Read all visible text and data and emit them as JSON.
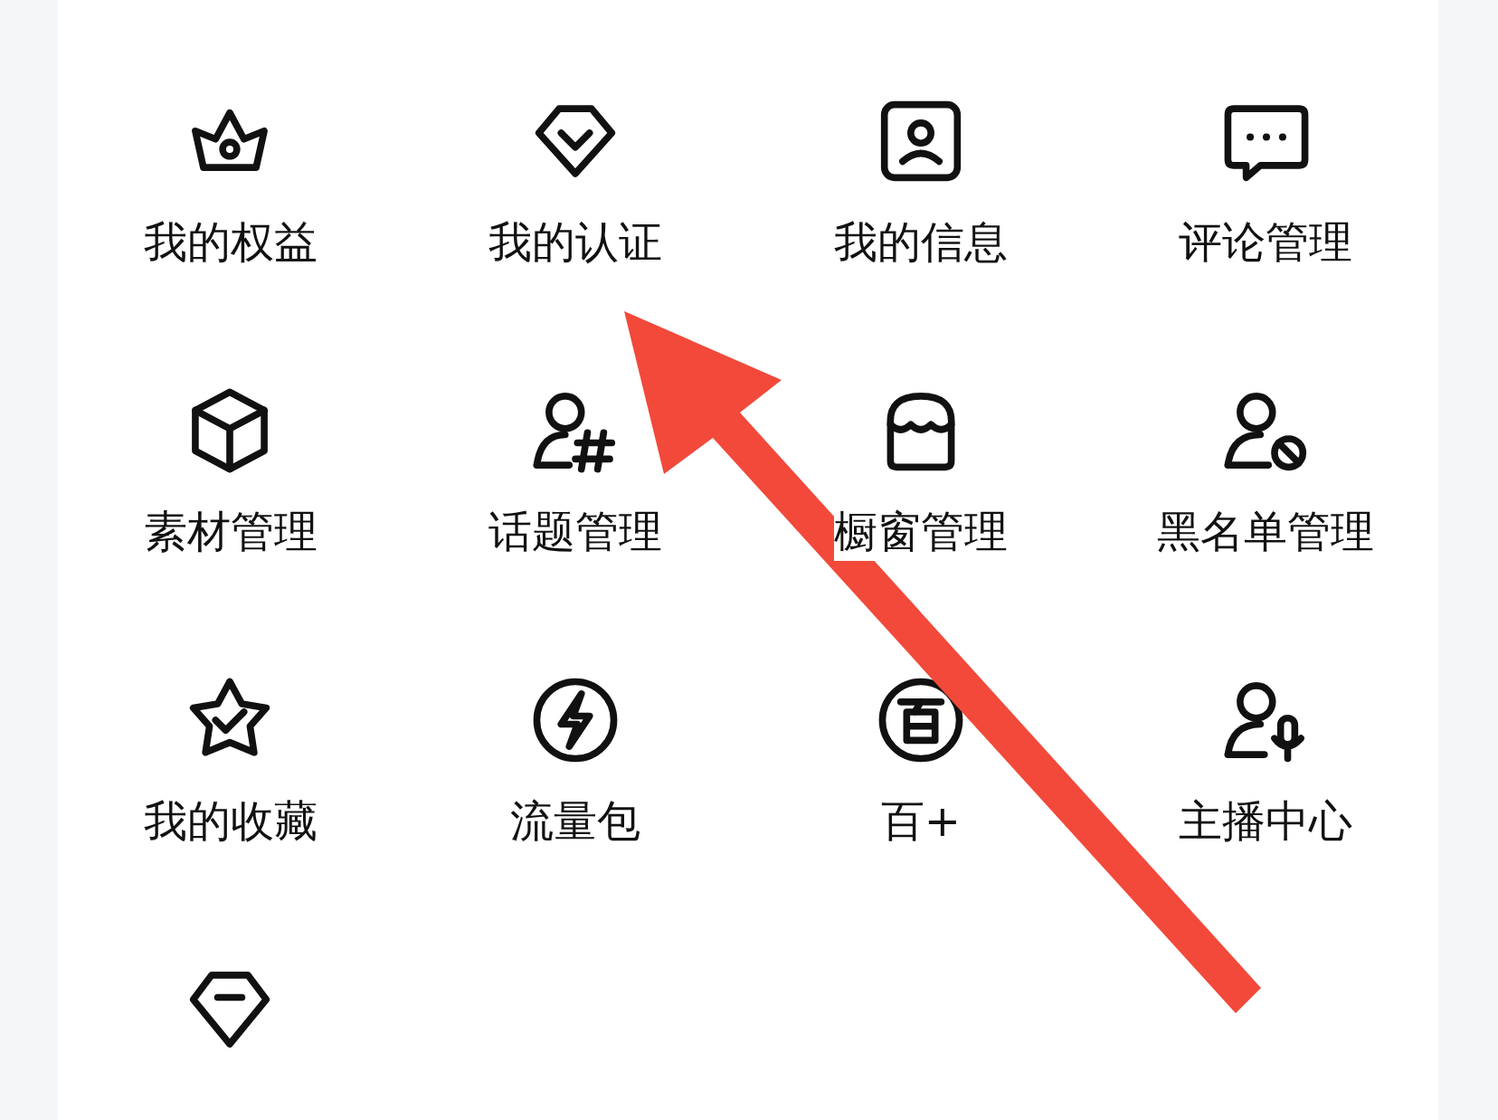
{
  "grid": {
    "items": [
      {
        "kind": "labeled",
        "label": "我的权益"
      },
      {
        "kind": "labeled",
        "label": "我的认证"
      },
      {
        "kind": "labeled",
        "label": "我的信息"
      },
      {
        "kind": "labeled",
        "label": "评论管理"
      },
      {
        "kind": "labeled",
        "label": "素材管理"
      },
      {
        "kind": "labeled",
        "label": "话题管理"
      },
      {
        "kind": "labeled",
        "label": "橱窗管理"
      },
      {
        "kind": "labeled",
        "label": "黑名单管理"
      },
      {
        "kind": "labeled",
        "label": "我的收藏"
      },
      {
        "kind": "labeled",
        "label": "流量包"
      },
      {
        "kind": "labeled",
        "label": "百+"
      },
      {
        "kind": "labeled",
        "label": "主播中心"
      },
      {
        "kind": "icon_only"
      }
    ]
  },
  "annotation": {
    "kind": "arrow"
  }
}
